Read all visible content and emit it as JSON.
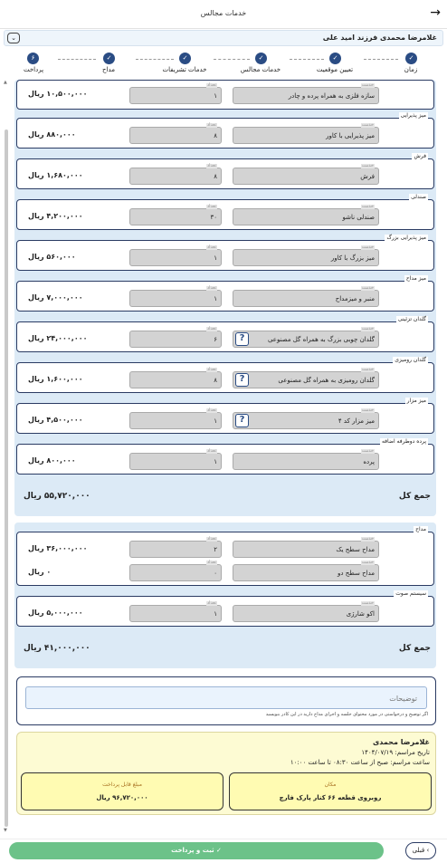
{
  "header": {
    "title": "خدمات مجالس",
    "back_icon": "→"
  },
  "customer": {
    "name": "غلامرضا محمدی فرزند امید علی",
    "toggle_icon": "⌄"
  },
  "steps": [
    {
      "label": "زمان",
      "icon": "✓"
    },
    {
      "label": "تعیین موقعیت",
      "icon": "✓"
    },
    {
      "label": "خدمات مجالس",
      "icon": "✓"
    },
    {
      "label": "خدمات تشریفات",
      "icon": "✓"
    },
    {
      "label": "مداح",
      "icon": "✓"
    },
    {
      "label": "پرداخت",
      "icon": "۶"
    }
  ],
  "labels": {
    "service": "خدمت",
    "quantity": "تعداد",
    "total": "جمع کل",
    "help": "?"
  },
  "section1": {
    "items": [
      {
        "category": "",
        "service": "سازه فلزی به همراه پرده و چادر",
        "qty": "۱",
        "price": "۱۰,۵۰۰,۰۰۰ ریال",
        "help": false
      },
      {
        "category": "میز پذیرایی",
        "service": "میز پذیرایی با کاور",
        "qty": "۸",
        "price": "۸۸۰,۰۰۰ ریال",
        "help": false
      },
      {
        "category": "فرش",
        "service": "فرش",
        "qty": "۸",
        "price": "۱,۶۸۰,۰۰۰ ریال",
        "help": false
      },
      {
        "category": "صندلی",
        "service": "صندلی ناشو",
        "qty": "۳۰",
        "price": "۴,۲۰۰,۰۰۰ ریال",
        "help": false
      },
      {
        "category": "میز پذیرایی بزرگ",
        "service": "میز بزرگ با کاور",
        "qty": "۱",
        "price": "۵۶۰,۰۰۰ ریال",
        "help": false
      },
      {
        "category": "میز مداح",
        "service": "منبر و میزمداح",
        "qty": "۱",
        "price": "۷,۰۰۰,۰۰۰ ریال",
        "help": false
      },
      {
        "category": "گلدان تزئینی",
        "service": "گلدان چوبی بزرگ به همراه گل مصنوعی",
        "qty": "۶",
        "price": "۲۴,۰۰۰,۰۰۰ ریال",
        "help": true
      },
      {
        "category": "گلدان رومیزی",
        "service": "گلدان رومیزی به همراه گل مصنوعی",
        "qty": "۸",
        "price": "۱,۶۰۰,۰۰۰ ریال",
        "help": true
      },
      {
        "category": "میز مزار",
        "service": "میز مزار کد ۴",
        "qty": "۱",
        "price": "۴,۵۰۰,۰۰۰ ریال",
        "help": true
      },
      {
        "category": "پرده دوطرفه اضافه",
        "service": "پرده",
        "qty": "۱",
        "price": "۸۰۰,۰۰۰ ریال",
        "help": false
      }
    ],
    "total": "۵۵,۷۲۰,۰۰۰ ریال"
  },
  "section2": {
    "madah": {
      "category": "مداح",
      "rows": [
        {
          "service": "مداح سطح یک",
          "qty": "۲",
          "price": "۳۶,۰۰۰,۰۰۰ ریال"
        },
        {
          "service": "مداح سطح دو",
          "qty": "۰",
          "price": "۰ ریال"
        }
      ]
    },
    "sound": {
      "category": "سیستم صوت",
      "service": "اکو شارژی",
      "qty": "۱",
      "price": "۵,۰۰۰,۰۰۰ ریال"
    },
    "total": "۴۱,۰۰۰,۰۰۰ ریال"
  },
  "description": {
    "placeholder": "توضیحات",
    "hint": "اگر توضیح و درخواستی در مورد محتوای جلسه و اجرای مداح دارید در این کادر بنویسید"
  },
  "summary": {
    "name": "غلامرضا محمدی",
    "date_line": "تاریخ مراسم: ۱۴۰۴/۰۷/۱۹",
    "time_line": "ساعت مراسم: صبح از ساعت ۰۸:۳۰ تا ساعت ۱۰:۰۰",
    "location_label": "مکان",
    "location_value": "روبروی قطعه ۶۶ کنار پارک فارچ",
    "amount_label": "مبلغ قابل پرداخت",
    "amount_value": "۹۶,۷۲۰,۰۰۰ ریال"
  },
  "footer": {
    "pay_label": "ثبت و پرداخت ✓",
    "prev_label": "قبلی ‹"
  }
}
